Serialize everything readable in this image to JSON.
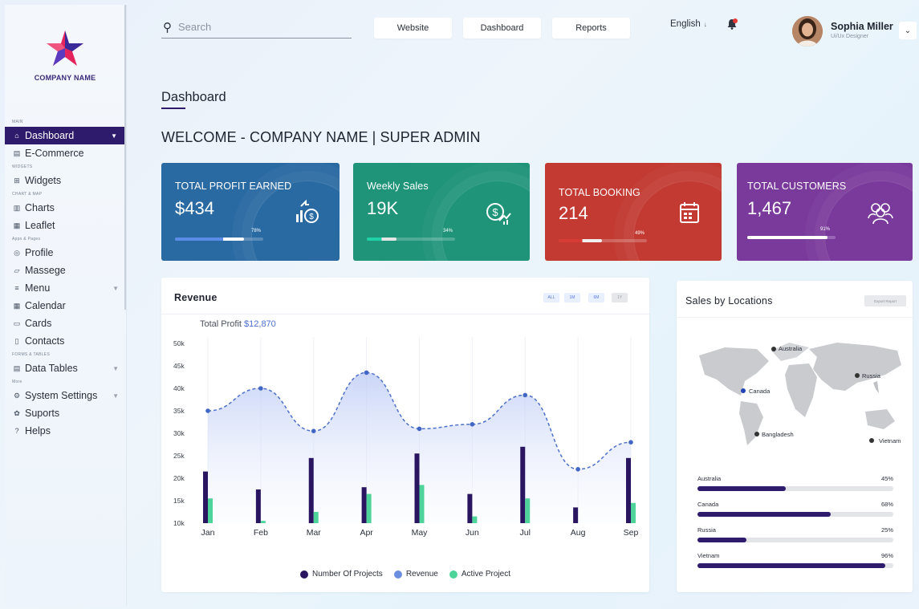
{
  "brand": {
    "company_name": "COMPANY NAME",
    "logo_colors": [
      "#e4245d",
      "#3a2a9a"
    ]
  },
  "sidebar": {
    "sections": {
      "main": "MAIN",
      "widgets": "WIDGETS",
      "chart_map": "CHART & MAP",
      "apps_pages": "Apps & Pages",
      "forms_tables": "FORMS & TABLES",
      "more": "More"
    },
    "items": {
      "dashboard": "Dashboard",
      "ecommerce": "E-Commerce",
      "widgets": "Widgets",
      "charts": "Charts",
      "leaflet": "Leaflet",
      "profile": "Profile",
      "massege": "Massege",
      "menu": "Menu",
      "calendar": "Calendar",
      "cards": "Cards",
      "contacts": "Contacts",
      "data_tables": "Data Tables",
      "system_settings": "System Settings",
      "suports": "Suports",
      "helps": "Helps"
    }
  },
  "topbar": {
    "search_placeholder": "Search",
    "website": "Website",
    "dashboard": "Dashboard",
    "reports": "Reports",
    "language": "English",
    "user_name": "Sophia Miller",
    "user_role": "Ui/Ux Designer"
  },
  "page": {
    "title": "Dashboard",
    "welcome": "WELCOME - COMPANY NAME  | SUPER ADMIN"
  },
  "stats": [
    {
      "label": "TOTAL PROFIT EARNED",
      "value": "$434",
      "pct_label": "78%",
      "progress": 0.78,
      "bg": "#2a6aa3",
      "fill": "#7fb0ff",
      "icon": "chart-dollar-icon"
    },
    {
      "label": "Weekly Sales",
      "value": "19K",
      "pct_label": "34%",
      "progress": 0.34,
      "bg": "#1f9479",
      "fill": "#1ed1a6",
      "icon": "dollar-trend-icon"
    },
    {
      "label": "TOTAL BOOKING",
      "value": "214",
      "pct_label": "49%",
      "progress": 0.49,
      "bg": "#c23a32",
      "fill": "#d63c34",
      "icon": "calendar-icon"
    },
    {
      "label": "TOTAL CUSTOMERS",
      "value": "1,467",
      "pct_label": "91%",
      "progress": 0.91,
      "bg": "#7a3a9b",
      "fill": "#7a3a9b",
      "icon": "customers-icon"
    }
  ],
  "revenue": {
    "title": "Revenue",
    "ranges": [
      "ALL",
      "1M",
      "6M",
      "1Y"
    ],
    "selected_range": "1Y",
    "total_profit_label": "Total Profit",
    "total_profit_value": "$12,870"
  },
  "locations": {
    "title": "Sales by Locations",
    "export_label": "Export Report",
    "map_labels": [
      "Australia",
      "Canada",
      "Russia",
      "Bangladesh",
      "Vietnam"
    ],
    "rows": [
      {
        "name": "Australia",
        "pct_label": "45%",
        "value": 0.45
      },
      {
        "name": "Canada",
        "pct_label": "68%",
        "value": 0.68
      },
      {
        "name": "Russia",
        "pct_label": "25%",
        "value": 0.25
      },
      {
        "name": "Vietnam",
        "pct_label": "96%",
        "value": 0.96
      }
    ]
  },
  "chart_data": {
    "type": "bar",
    "categories": [
      "Jan",
      "Feb",
      "Mar",
      "Apr",
      "May",
      "Jun",
      "Jul",
      "Aug",
      "Sep"
    ],
    "y_ticks": [
      "50k",
      "45k",
      "40k",
      "35k",
      "30k",
      "25k",
      "20k",
      "15k",
      "10k"
    ],
    "ylim": [
      10,
      50
    ],
    "series": [
      {
        "name": "Number Of Projects",
        "type": "bar",
        "color": "#2a1660",
        "values": [
          21.5,
          17.5,
          24.5,
          18,
          25.5,
          16.5,
          27,
          13.5,
          24.5
        ]
      },
      {
        "name": "Active Project",
        "type": "bar",
        "color": "#4ed39a",
        "values": [
          15.5,
          10.5,
          12.5,
          16.5,
          18.5,
          11.5,
          15.5,
          10,
          14.5
        ]
      },
      {
        "name": "Revenue",
        "type": "area",
        "color": "#4b6fd1",
        "values": [
          35,
          40,
          30.5,
          43.5,
          31,
          32,
          38.5,
          22,
          28
        ]
      }
    ],
    "grid": true,
    "legend_position": "bottom"
  }
}
